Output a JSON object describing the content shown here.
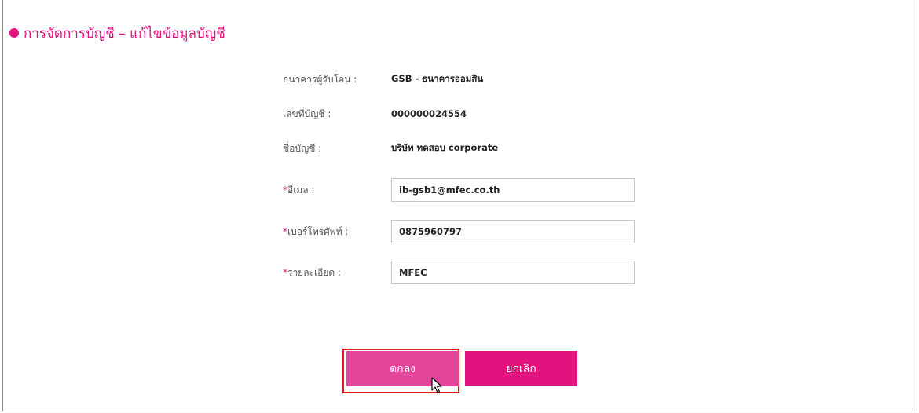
{
  "header": {
    "title": "การจัดการบัญชี – แก้ไขข้อมูลบัญชี"
  },
  "form": {
    "bank": {
      "label": "ธนาคารผู้รับโอน :",
      "value": "GSB - ธนาคารออมสิน"
    },
    "account_number": {
      "label": "เลขที่บัญชี :",
      "value": "000000024554"
    },
    "account_name": {
      "label": "ชื่อบัญชี :",
      "value": "บริษัท ทดสอบ corporate"
    },
    "email": {
      "required_mark": "*",
      "label": "อีเมล :",
      "value": "ib-gsb1@mfec.co.th"
    },
    "phone": {
      "required_mark": "*",
      "label": "เบอร์โทรศัพท์ :",
      "value": "0875960797"
    },
    "detail": {
      "required_mark": "*",
      "label": "รายละเอียด :",
      "value": "MFEC"
    }
  },
  "actions": {
    "ok_label": "ตกลง",
    "cancel_label": "ยกเลิก"
  },
  "colors": {
    "accent": "#e2137e",
    "focus_outline": "#e21a22"
  },
  "icons": {
    "cursor": "mouse-pointer-icon"
  }
}
